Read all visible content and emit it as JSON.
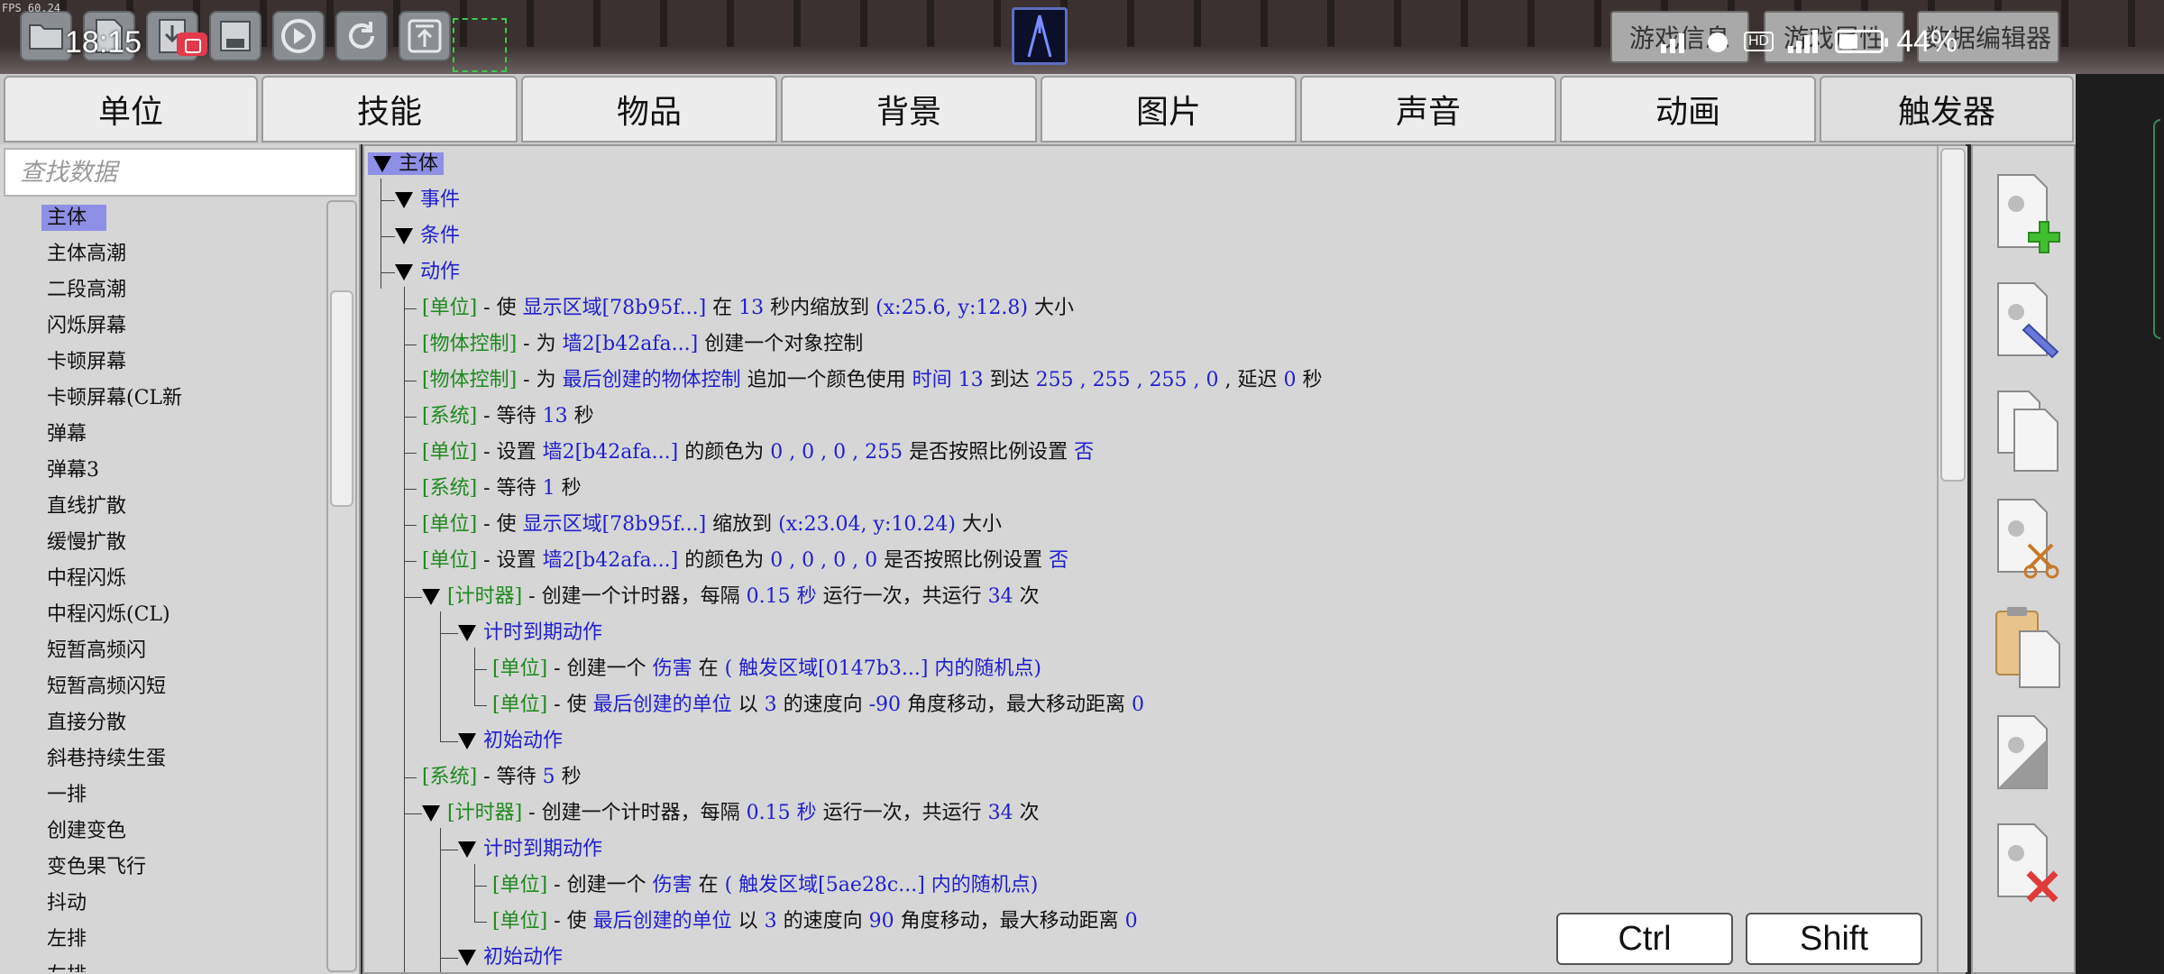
{
  "status": {
    "fps": "FPS 60.24",
    "time": "18:15",
    "battery": "44%",
    "hd": "HD"
  },
  "top_buttons": [
    {
      "label": "游戏信息"
    },
    {
      "label": "游戏属性"
    },
    {
      "label": "数据编辑器"
    }
  ],
  "tabs": [
    {
      "label": "单位"
    },
    {
      "label": "技能"
    },
    {
      "label": "物品"
    },
    {
      "label": "背景"
    },
    {
      "label": "图片"
    },
    {
      "label": "声音"
    },
    {
      "label": "动画"
    },
    {
      "label": "触发器"
    }
  ],
  "search": {
    "placeholder": "查找数据"
  },
  "list": [
    "主体",
    "主体高潮",
    "二段高潮",
    "闪烁屏幕",
    "卡顿屏幕",
    "卡顿屏幕(CL新",
    "弹幕",
    "弹幕3",
    "直线扩散",
    "缓慢扩散",
    "中程闪烁",
    "中程闪烁(CL)",
    "短暂高频闪",
    "短暂高频闪短",
    "直接分散",
    "斜巷持续生蛋",
    "一排",
    "创建变色",
    "变色果飞行",
    "抖动",
    "左排",
    "左排"
  ],
  "tree": {
    "root": "主体",
    "event": "事件",
    "condition": "条件",
    "action": "动作",
    "a1": {
      "cat": "[单位]",
      "t1": " - 使 ",
      "b1": "显示区域[78b95f...]",
      "t2": " 在 ",
      "b2": "13",
      "t3": " 秒内缩放到 ",
      "b3": "(x:25.6, y:12.8)",
      "t4": " 大小"
    },
    "a2": {
      "cat": "[物体控制]",
      "t1": " - 为 ",
      "b1": "墙2[b42afa...]",
      "t2": " 创建一个对象控制"
    },
    "a3": {
      "cat": "[物体控制]",
      "t1": " - 为 ",
      "b1": "最后创建的物体控制",
      "t2": " 追加一个颜色使用 ",
      "b2": "时间  13",
      "t3": " 到达 ",
      "b3": "255 , 255 , 255 , 0",
      "t4": " , 延迟 ",
      "b4": "0",
      "t5": " 秒"
    },
    "a4": {
      "cat": "[系统]",
      "t1": " - 等待 ",
      "b1": "13",
      "t2": " 秒"
    },
    "a5": {
      "cat": "[单位]",
      "t1": " - 设置 ",
      "b1": "墙2[b42afa...]",
      "t2": " 的颜色为 ",
      "b2": "0 , 0 , 0 , 255",
      "t3": " 是否按照比例设置 ",
      "b3": "否"
    },
    "a6": {
      "cat": "[系统]",
      "t1": " - 等待 ",
      "b1": "1",
      "t2": " 秒"
    },
    "a7": {
      "cat": "[单位]",
      "t1": " - 使 ",
      "b1": "显示区域[78b95f...]",
      "t2": " 缩放到 ",
      "b2": "(x:23.04, y:10.24)",
      "t3": " 大小"
    },
    "a8": {
      "cat": "[单位]",
      "t1": " - 设置 ",
      "b1": "墙2[b42afa...]",
      "t2": " 的颜色为 ",
      "b2": "0 , 0 , 0 , 0",
      "t3": " 是否按照比例设置 ",
      "b3": "否"
    },
    "a9": {
      "cat": "[计时器]",
      "t1": " - 创建一个计时器，每隔 ",
      "b1": "0.15  秒",
      "t2": " 运行一次，共运行 ",
      "b2": "34",
      "t3": " 次"
    },
    "a9_exp": "计时到期动作",
    "a9_1": {
      "cat": "[单位]",
      "t1": " - 创建一个 ",
      "b1": "伤害",
      "t2": " 在 ",
      "b2": "( 触发区域[0147b3...] 内的随机点)"
    },
    "a9_2": {
      "cat": "[单位]",
      "t1": " - 使 ",
      "b1": "最后创建的单位",
      "t2": " 以 ",
      "b2": "3",
      "t3": " 的速度向 ",
      "b3": "-90",
      "t4": " 角度移动，最大移动距离 ",
      "b4": "0"
    },
    "a9_init": "初始动作",
    "a10": {
      "cat": "[系统]",
      "t1": " - 等待 ",
      "b1": "5",
      "t2": " 秒"
    },
    "a11": {
      "cat": "[计时器]",
      "t1": " - 创建一个计时器，每隔 ",
      "b1": "0.15  秒",
      "t2": " 运行一次，共运行 ",
      "b2": "34",
      "t3": " 次"
    },
    "a11_exp": "计时到期动作",
    "a11_1": {
      "cat": "[单位]",
      "t1": " - 创建一个 ",
      "b1": "伤害",
      "t2": " 在 ",
      "b2": "( 触发区域[5ae28c...] 内的随机点)"
    },
    "a11_2": {
      "cat": "[单位]",
      "t1": " - 使 ",
      "b1": "最后创建的单位",
      "t2": " 以 ",
      "b2": "3",
      "t3": " 的速度向 ",
      "b3": "90",
      "t4": " 角度移动，最大移动距离 ",
      "b4": "0"
    },
    "a11_init": "初始动作"
  },
  "keys": {
    "ctrl": "Ctrl",
    "shift": "Shift"
  },
  "right_tools": [
    "new-trigger-icon",
    "edit-trigger-icon",
    "copy-icon",
    "cut-icon",
    "paste-icon",
    "blank-page-icon",
    "delete-icon"
  ],
  "colors": {
    "category": "#1e8a1e",
    "param": "#1f1fcf",
    "selection": "#8f8fe6"
  }
}
